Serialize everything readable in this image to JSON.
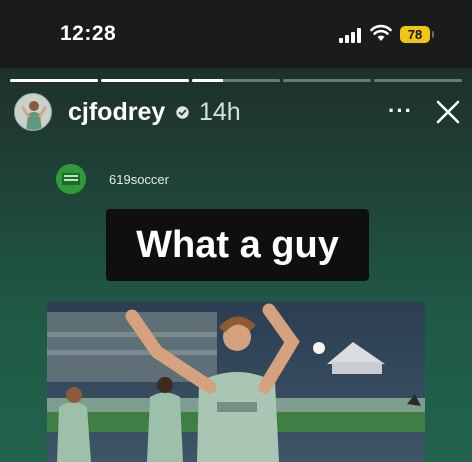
{
  "status_bar": {
    "time": "12:28",
    "battery_level": "78",
    "signal_icon": "cellular-signal-icon",
    "wifi_icon": "wifi-icon"
  },
  "story": {
    "progress_segments": [
      1,
      1,
      0.35,
      0,
      0
    ],
    "username": "cjfodrey",
    "verified_icon": "verified-badge-icon",
    "age": "14h",
    "more_label": "···",
    "close_icon": "close-icon"
  },
  "repost": {
    "name": "619soccer"
  },
  "caption": "What a guy",
  "colors": {
    "battery": "#f2c511",
    "background_top": "#1c2624",
    "background_bottom": "#22634d",
    "caption_bg": "#0f0f0f"
  }
}
